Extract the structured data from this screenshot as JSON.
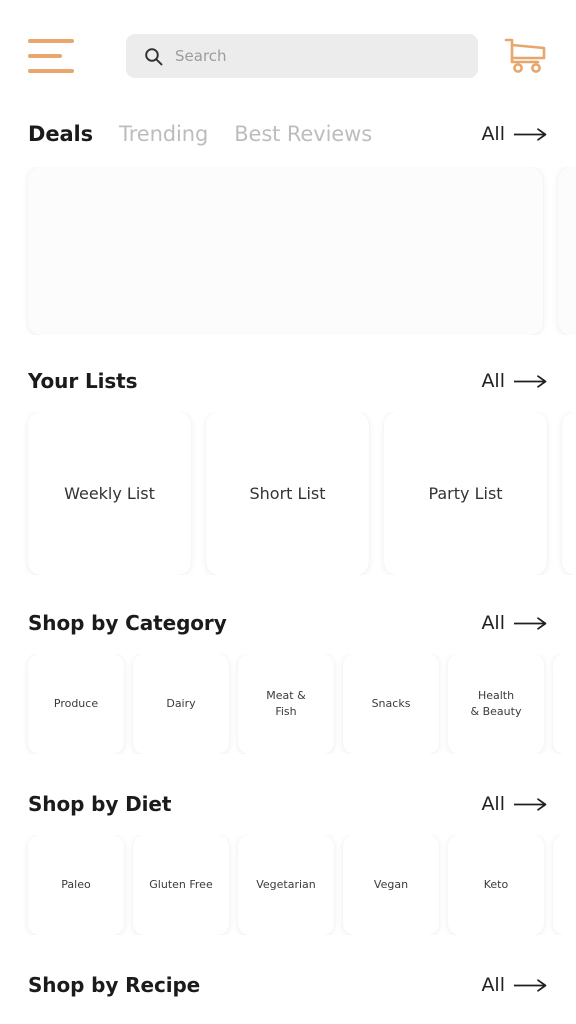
{
  "header": {
    "menu_icon": "hamburger-menu-icon",
    "cart_icon": "shopping-cart-icon",
    "search": {
      "icon": "search-icon",
      "value": "",
      "placeholder": "Search"
    }
  },
  "colors": {
    "accent": "#e8a66c",
    "text_primary": "#1b1b1b",
    "text_muted": "#bdbdbd",
    "search_bg": "#ececec",
    "page_bg": "#ffffff",
    "card_bg": "#ffffff"
  },
  "deals_tabs": {
    "items": [
      {
        "label": "Deals",
        "active": true
      },
      {
        "label": "Trending",
        "active": false
      },
      {
        "label": "Best Reviews",
        "active": false
      }
    ],
    "all_label": "All"
  },
  "deals_rail": {
    "cards": [
      {
        "label": ""
      },
      {
        "label": ""
      }
    ]
  },
  "your_lists": {
    "title": "Your Lists",
    "all_label": "All",
    "items": [
      {
        "label": "Weekly List"
      },
      {
        "label": "Short List"
      },
      {
        "label": "Party List"
      },
      {
        "label": ""
      }
    ]
  },
  "shop_by_category": {
    "title": "Shop by Category",
    "all_label": "All",
    "items": [
      {
        "label": "Produce"
      },
      {
        "label": "Dairy"
      },
      {
        "label": "Meat &\nFish"
      },
      {
        "label": "Snacks"
      },
      {
        "label": "Health\n& Beauty"
      },
      {
        "label": ""
      }
    ]
  },
  "shop_by_diet": {
    "title": "Shop by Diet",
    "all_label": "All",
    "items": [
      {
        "label": "Paleo"
      },
      {
        "label": "Gluten Free"
      },
      {
        "label": "Vegetarian"
      },
      {
        "label": "Vegan"
      },
      {
        "label": "Keto"
      },
      {
        "label": ""
      }
    ]
  },
  "shop_by_recipe": {
    "title": "Shop by Recipe",
    "all_label": "All"
  }
}
